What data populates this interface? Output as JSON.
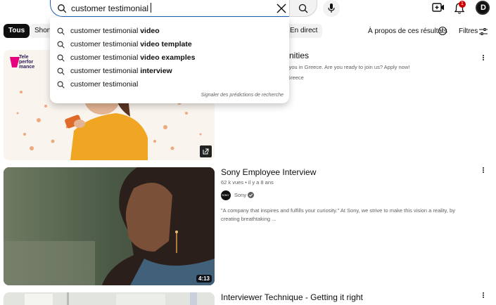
{
  "search": {
    "query": "customer testimonial"
  },
  "header": {
    "notification_count": "1",
    "avatar_letter": "D"
  },
  "chips": [
    {
      "label": "Tous"
    },
    {
      "label": "Short"
    },
    {
      "label": "En direct"
    }
  ],
  "about_results_label": "À propos de ces résultats",
  "filters_label": "Filtres",
  "suggestions": [
    {
      "prefix": "customer testimonial ",
      "bold": "video"
    },
    {
      "prefix": "customer testimonial ",
      "bold": "video template"
    },
    {
      "prefix": "customer testimonial ",
      "bold": "video examples"
    },
    {
      "prefix": "customer testimonial ",
      "bold": "interview"
    },
    {
      "prefix": "customer testimonial",
      "bold": ""
    }
  ],
  "report_predictions_label": "Signaler des prédictions de recherche",
  "results": [
    {
      "title_visible": "rtunities",
      "desc_visible": "sit you in Greece. Are you ready to join us? Apply now!",
      "meta_visible": "e Greece",
      "thumb_logo": "Tele perfor mance"
    },
    {
      "title": "Sony Employee Interview",
      "views": "62 k vues",
      "age": "il y a 8 ans",
      "channel": "Sony",
      "channel_avatar_text": "SONY",
      "description": "\"A company that inspires and fulfills your curiosity.\" At Sony, we strive to make this vision a reality, by creating breathtaking ...",
      "duration": "4:13"
    },
    {
      "title": "Interviewer Technique - Getting it right"
    }
  ],
  "colors": {
    "accent_blue": "#1c62b9",
    "badge_red": "#cc0000",
    "text_primary": "#0f0f0f",
    "text_secondary": "#606060"
  }
}
